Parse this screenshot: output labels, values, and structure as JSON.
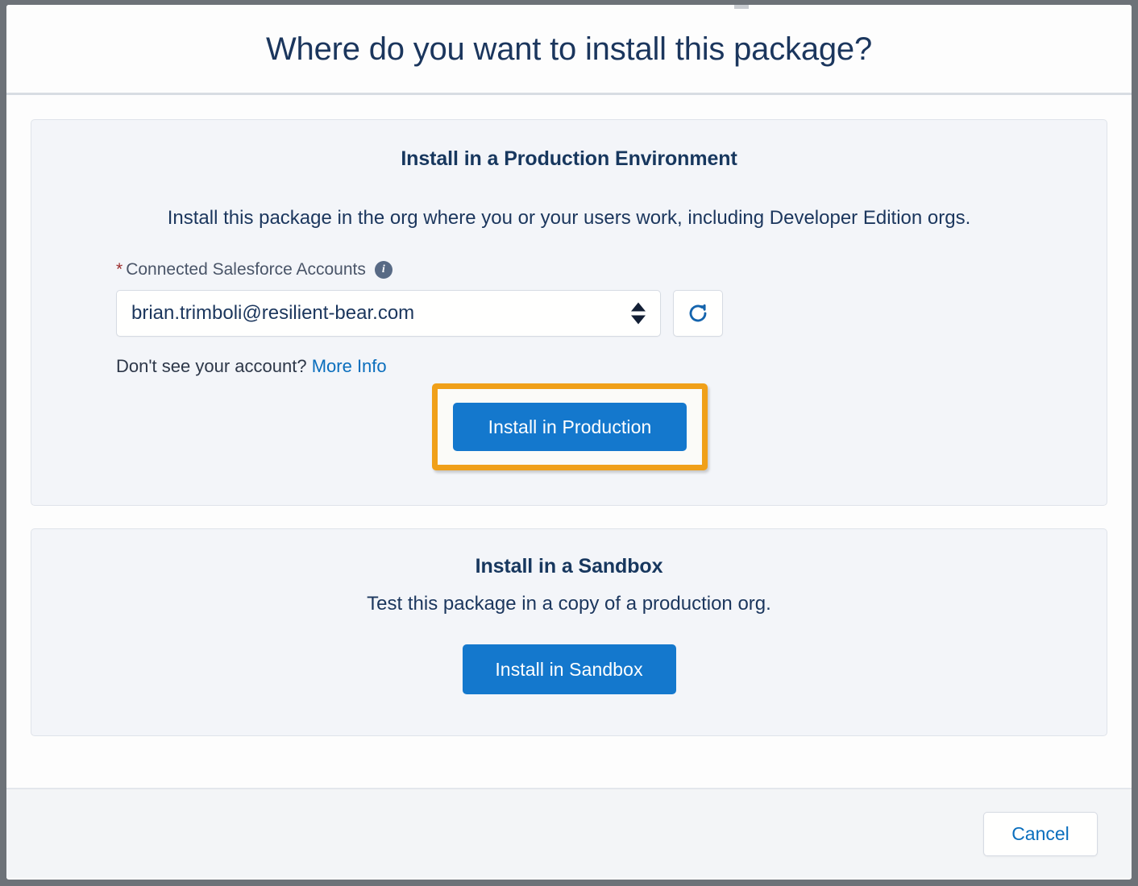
{
  "modal": {
    "title": "Where do you want to install this package?"
  },
  "production": {
    "heading": "Install in a Production Environment",
    "description": "Install this package in the org where you or your users work, including Developer Edition orgs.",
    "field": {
      "required_marker": "*",
      "label": "Connected Salesforce Accounts",
      "info_icon": "info-icon",
      "selected_value": "brian.trimboli@resilient-bear.com",
      "stepper_up_icon": "triangle-up-icon",
      "stepper_down_icon": "triangle-down-icon"
    },
    "refresh_icon": "refresh-icon",
    "help_text": "Don't see your account?",
    "help_link": "More Info",
    "install_button": "Install in Production",
    "highlight_color": "#f0a019"
  },
  "sandbox": {
    "heading": "Install in a Sandbox",
    "description": "Test this package in a copy of a production org.",
    "install_button": "Install in Sandbox"
  },
  "footer": {
    "cancel_button": "Cancel"
  },
  "colors": {
    "primary_blue": "#1478cd",
    "link_blue": "#0a6ebd",
    "heading_navy": "#17375e",
    "card_bg": "#f3f5f9",
    "required_red": "#9b2c2c",
    "highlight_orange": "#f0a019"
  }
}
